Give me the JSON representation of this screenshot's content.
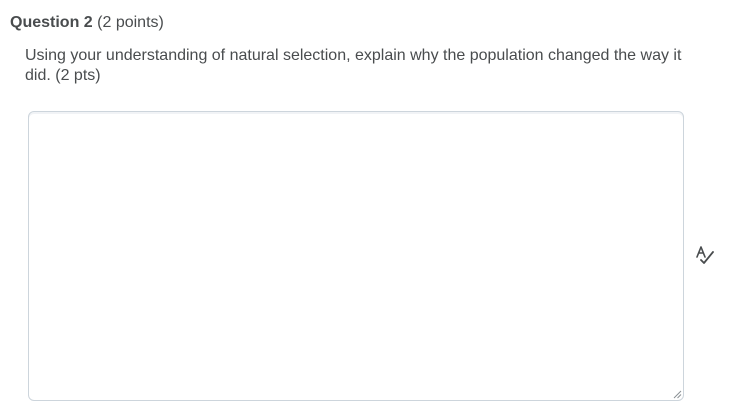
{
  "question": {
    "title": "Question 2",
    "points": "(2 points)",
    "prompt": "Using your understanding of natural selection, explain why the population changed the way it did. (2 pts)"
  },
  "answer": {
    "value": ""
  },
  "icons": {
    "spellcheck": "spellcheck-icon",
    "resize": "resize-handle-icon"
  },
  "colors": {
    "text": "#494c4e",
    "border": "#cdd5dc"
  }
}
